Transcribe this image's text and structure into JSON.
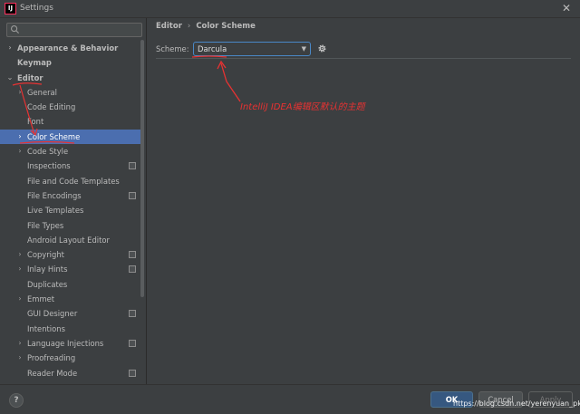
{
  "window": {
    "title": "Settings",
    "app_icon_text": "IJ"
  },
  "sidebar": {
    "search": {
      "value": "",
      "placeholder": ""
    },
    "items": [
      {
        "label": "Appearance & Behavior",
        "level": 0,
        "expandable": true,
        "expanded": false,
        "bold": true
      },
      {
        "label": "Keymap",
        "level": 0,
        "expandable": false,
        "bold": true
      },
      {
        "label": "Editor",
        "level": 0,
        "expandable": true,
        "expanded": true,
        "bold": true
      },
      {
        "label": "General",
        "level": 1,
        "expandable": true,
        "expanded": false
      },
      {
        "label": "Code Editing",
        "level": 1,
        "expandable": false
      },
      {
        "label": "Font",
        "level": 1,
        "expandable": false
      },
      {
        "label": "Color Scheme",
        "level": 1,
        "expandable": true,
        "expanded": false,
        "selected": true
      },
      {
        "label": "Code Style",
        "level": 1,
        "expandable": true,
        "expanded": false
      },
      {
        "label": "Inspections",
        "level": 1,
        "expandable": false,
        "project_icon": true
      },
      {
        "label": "File and Code Templates",
        "level": 1,
        "expandable": false
      },
      {
        "label": "File Encodings",
        "level": 1,
        "expandable": false,
        "project_icon": true
      },
      {
        "label": "Live Templates",
        "level": 1,
        "expandable": false
      },
      {
        "label": "File Types",
        "level": 1,
        "expandable": false
      },
      {
        "label": "Android Layout Editor",
        "level": 1,
        "expandable": false
      },
      {
        "label": "Copyright",
        "level": 1,
        "expandable": true,
        "expanded": false,
        "project_icon": true
      },
      {
        "label": "Inlay Hints",
        "level": 1,
        "expandable": true,
        "expanded": false,
        "project_icon": true
      },
      {
        "label": "Duplicates",
        "level": 1,
        "expandable": false
      },
      {
        "label": "Emmet",
        "level": 1,
        "expandable": true,
        "expanded": false
      },
      {
        "label": "GUI Designer",
        "level": 1,
        "expandable": false,
        "project_icon": true
      },
      {
        "label": "Intentions",
        "level": 1,
        "expandable": false
      },
      {
        "label": "Language Injections",
        "level": 1,
        "expandable": true,
        "expanded": false,
        "project_icon": true
      },
      {
        "label": "Proofreading",
        "level": 1,
        "expandable": true,
        "expanded": false
      },
      {
        "label": "Reader Mode",
        "level": 1,
        "expandable": false,
        "project_icon": true
      }
    ]
  },
  "main": {
    "breadcrumb": [
      "Editor",
      "Color Scheme"
    ],
    "breadcrumb_separator": "›",
    "scheme_label": "Scheme:",
    "scheme_value": "Darcula"
  },
  "annotation": {
    "text": "IntelliJ IDEA编辑区默认的主题",
    "color": "#e83232"
  },
  "footer": {
    "help_label": "?",
    "ok_label": "OK",
    "cancel_label": "Cancel",
    "apply_label": "Apply"
  },
  "watermark": "https://blog.csdn.net/yerenyuan_pku",
  "colors": {
    "background": "#3c3f41",
    "selection": "#4b6eaf",
    "focus_border": "#4a88c7",
    "ok_button": "#365880"
  },
  "icons": {
    "search": "search-icon",
    "close": "close-icon",
    "gear": "gear-icon",
    "dropdown": "chevron-down-icon",
    "tree_collapsed": "chevron-right-icon",
    "tree_expanded": "chevron-down-icon",
    "project": "project-scope-icon"
  }
}
